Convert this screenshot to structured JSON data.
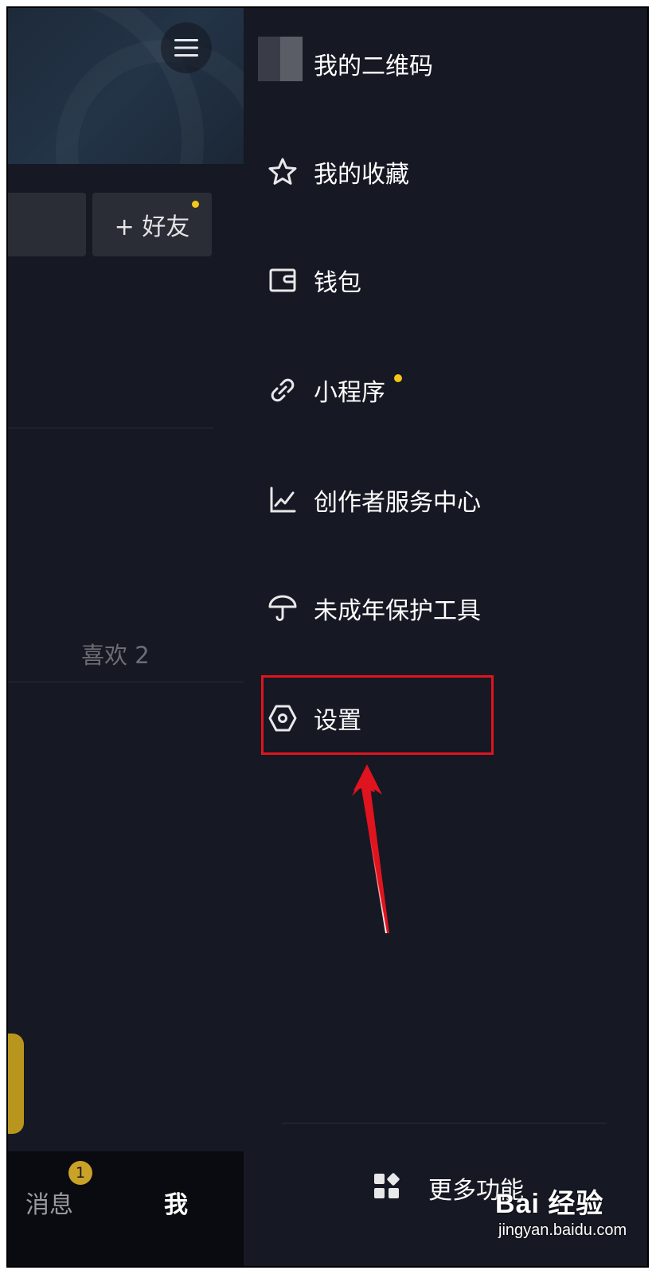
{
  "left_page": {
    "add_friend_label": "+ 好友",
    "likes_label": "喜欢 2",
    "tabs": [
      {
        "label": "消息",
        "badge": "1"
      },
      {
        "label": "我"
      }
    ]
  },
  "drawer": {
    "items": [
      {
        "label": "我的二维码",
        "icon": "qr-code-thumbnail"
      },
      {
        "label": "我的收藏",
        "icon": "star-icon"
      },
      {
        "label": "钱包",
        "icon": "wallet-icon"
      },
      {
        "label": "小程序",
        "icon": "link-icon",
        "dot": true
      },
      {
        "label": "创作者服务中心",
        "icon": "chart-line-icon"
      },
      {
        "label": "未成年保护工具",
        "icon": "umbrella-icon"
      },
      {
        "label": "设置",
        "icon": "hexagon-settings-icon",
        "highlighted": true
      }
    ],
    "more_label": "更多功能"
  },
  "watermark": {
    "top": "Bai 经验",
    "bottom": "jingyan.baidu.com"
  },
  "colors": {
    "background": "#161823",
    "accent_yellow": "#f5c518",
    "highlight_red": "#e0141e"
  }
}
